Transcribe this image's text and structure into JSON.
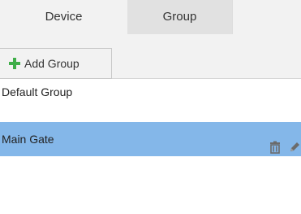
{
  "tabs": {
    "device_label": "Device",
    "group_label": "Group"
  },
  "toolbar": {
    "add_group_label": "Add Group",
    "add_icon": "plus-icon"
  },
  "groups": [
    {
      "label": "Default Group",
      "selected": false
    },
    {
      "label": "Main Gate",
      "selected": true
    }
  ],
  "row_actions": [
    "trash-icon",
    "pencil-icon"
  ],
  "colors": {
    "selected_row": "#84b7e9",
    "plus_icon": "#3fae49",
    "action_icon": "#6b6b6b"
  }
}
